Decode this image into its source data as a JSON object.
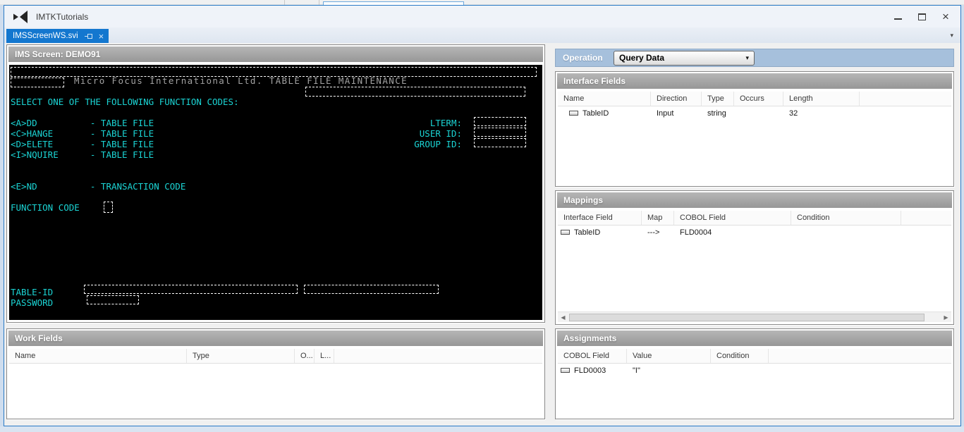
{
  "colors": {
    "outer_bg": "#cfddee",
    "window_border": "#2a7ac6",
    "titlebar_bg": "#eff3f9",
    "tab_active_bg": "#1377cf",
    "client_bg": "#f0f0f0",
    "panel_header_top": "#b6b6b6",
    "panel_header_bottom": "#979797",
    "panel_border": "#8a8a8a",
    "terminal_bg": "#000000",
    "terminal_fg": "#1bd4d4",
    "terminal_heading_fg": "#a2a2a2",
    "operation_bar_bg": "#a6c0dc"
  },
  "icons": {
    "close": "×",
    "tab_close": "×",
    "dropdown": "▾",
    "well_chevron": "▾",
    "scroll_left": "◀",
    "scroll_right": "▶"
  },
  "window": {
    "title": "IMTKTutorials",
    "tab_label": "IMSScreenWS.svi"
  },
  "terminal": {
    "panel_title": "IMS Screen: DEMO91",
    "heading": "Micro Focus International Ltd. TABLE FILE MAINTENANCE",
    "lines": [
      {
        "name": "terminal-line-select",
        "row": 3,
        "text": "SELECT ONE OF THE FOLLOWING FUNCTION CODES:"
      },
      {
        "name": "terminal-line-add",
        "row": 5,
        "text": "<A>DD          - TABLE FILE"
      },
      {
        "name": "terminal-line-change",
        "row": 6,
        "text": "<C>HANGE       - TABLE FILE"
      },
      {
        "name": "terminal-line-delete",
        "row": 7,
        "text": "<D>ELETE       - TABLE FILE"
      },
      {
        "name": "terminal-line-inquire",
        "row": 8,
        "text": "<I>NQUIRE      - TABLE FILE"
      },
      {
        "name": "terminal-line-end",
        "row": 11,
        "text": "<E>ND          - TRANSACTION CODE"
      },
      {
        "name": "terminal-line-function-code",
        "row": 13,
        "text": "FUNCTION CODE"
      },
      {
        "name": "terminal-line-table-id",
        "row": 21,
        "text": "TABLE-ID"
      },
      {
        "name": "terminal-line-password",
        "row": 22,
        "text": "PASSWORD"
      }
    ],
    "right_labels": [
      {
        "name": "lterm-label",
        "row": 5,
        "text": "LTERM:"
      },
      {
        "name": "user-id-label",
        "row": 6,
        "text": "USER ID:"
      },
      {
        "name": "group-id-label",
        "row": 7,
        "text": "GROUP ID:"
      }
    ]
  },
  "operation": {
    "label": "Operation",
    "value": "Query Data"
  },
  "tables": {
    "interface_fields": {
      "title": "Interface Fields",
      "columns": [
        "Name",
        "Direction",
        "Type",
        "Occurs",
        "Length"
      ],
      "rows": [
        [
          "TableID",
          "Input",
          "string",
          "",
          "32"
        ]
      ]
    },
    "mappings": {
      "title": "Mappings",
      "columns": [
        "Interface Field",
        "Map",
        "COBOL Field",
        "Condition"
      ],
      "rows": [
        [
          "TableID",
          "--->",
          "FLD0004",
          ""
        ]
      ]
    },
    "assignments": {
      "title": "Assignments",
      "columns": [
        "COBOL Field",
        "Value",
        "Condition"
      ],
      "rows": [
        [
          "FLD0003",
          "\"I\"",
          ""
        ]
      ]
    },
    "work_fields": {
      "title": "Work Fields",
      "columns": [
        "Name",
        "Type",
        "O...",
        "L..."
      ],
      "rows": []
    }
  }
}
